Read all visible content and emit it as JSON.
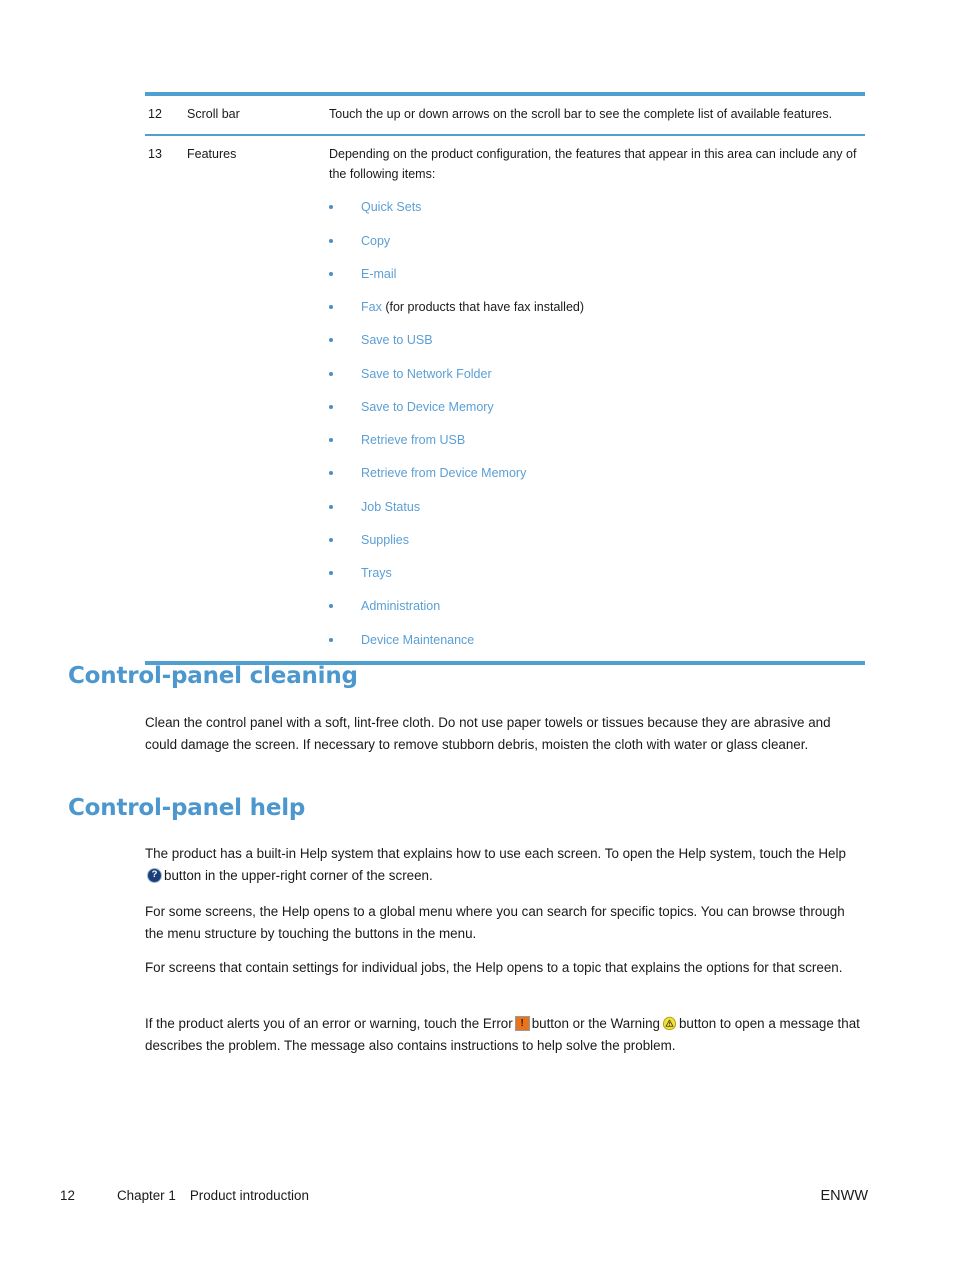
{
  "document": {
    "table": {
      "rows": [
        {
          "number": "12",
          "name": "Scroll bar",
          "description": "Touch the up or down arrows on the scroll bar to see the complete list of available features."
        },
        {
          "number": "13",
          "name": "Features",
          "description": "Depending on the product configuration, the features that appear in this area can include any of the following items:"
        }
      ],
      "feature_list": [
        {
          "label": "Quick Sets",
          "tail": ""
        },
        {
          "label": "Copy",
          "tail": ""
        },
        {
          "label": "E-mail",
          "tail": ""
        },
        {
          "label": "Fax",
          "tail": " (for products that have fax installed)"
        },
        {
          "label": "Save to USB",
          "tail": ""
        },
        {
          "label": "Save to Network Folder",
          "tail": ""
        },
        {
          "label": "Save to Device Memory",
          "tail": ""
        },
        {
          "label": "Retrieve from USB",
          "tail": ""
        },
        {
          "label": "Retrieve from Device Memory",
          "tail": ""
        },
        {
          "label": "Job Status",
          "tail": ""
        },
        {
          "label": "Supplies",
          "tail": ""
        },
        {
          "label": "Trays",
          "tail": ""
        },
        {
          "label": "Administration",
          "tail": ""
        },
        {
          "label": "Device Maintenance",
          "tail": ""
        }
      ]
    },
    "sections": {
      "cleaning": {
        "heading": "Control-panel cleaning",
        "paragraph": "Clean the control panel with a soft, lint-free cloth. Do not use paper towels or tissues because they are abrasive and could damage the screen. If necessary to remove stubborn debris, moisten the cloth with water or glass cleaner."
      },
      "help": {
        "heading": "Control-panel help",
        "paragraph_1_before": "The product has a built-in Help system that explains how to use each screen. To open the Help system, touch the Help",
        "paragraph_1_after": "button in the upper-right corner of the screen.",
        "paragraph_2": "For some screens, the Help opens to a global menu where you can search for specific topics. You can browse through the menu structure by touching the buttons in the menu.",
        "paragraph_3": "For screens that contain settings for individual jobs, the Help opens to a topic that explains the options for that screen.",
        "paragraph_4_a": "If the product alerts you of an error or warning, touch the Error",
        "paragraph_4_b": "button or the Warning",
        "paragraph_4_c": "button to open a message that describes the problem. The message also contains instructions to help solve the problem."
      }
    },
    "footer": {
      "page_number": "12",
      "chapter": "Chapter 1",
      "chapter_title": "Product introduction",
      "locale": "ENWW"
    },
    "icons": {
      "help": "help-question-icon",
      "error": "error-exclamation-icon",
      "warning": "warning-triangle-icon"
    },
    "colors": {
      "heading_blue": "#4d97cf",
      "rule_blue": "#4f9fd0",
      "list_blue": "#5b9fd4",
      "error_orange": "#e8741c",
      "warning_yellow": "#f5e03a",
      "help_navy": "#1b3f7a"
    }
  }
}
